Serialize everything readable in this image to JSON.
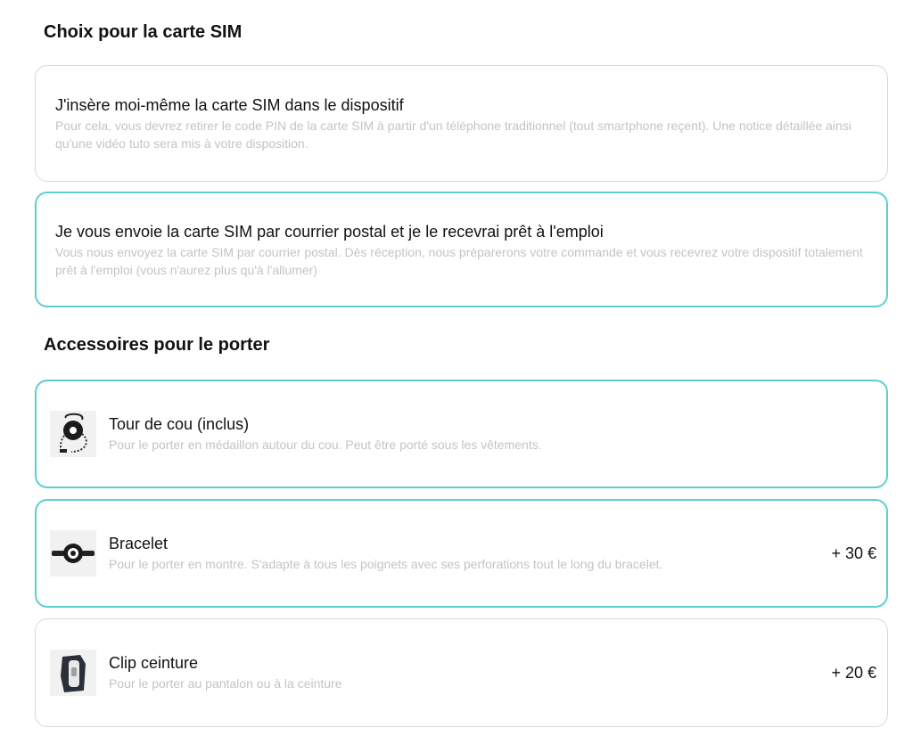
{
  "sim_section": {
    "title": "Choix pour la carte SIM",
    "options": [
      {
        "title": "J'insère moi-même la carte SIM dans le dispositif",
        "description": "Pour cela, vous devrez retirer le code PIN de la carte SIM à partir d'un téléphone traditionnel (tout smartphone reçent). Une notice détaillée ainsi qu'une vidéo tuto sera mis à votre disposition.",
        "selected": false
      },
      {
        "title": "Je vous envoie la carte SIM par courrier postal et je le recevrai prêt à l'emploi",
        "description": "Vous nous envoyez la carte SIM par courrier postal. Dès réception, nous préparerons votre commande et vous recevrez votre dispositif totalement prêt à l'emploi (vous n'aurez plus qu'à l'allumer)",
        "selected": true
      }
    ]
  },
  "accessories_section": {
    "title": "Accessoires pour le porter",
    "options": [
      {
        "icon": "necklace-device-image",
        "title": "Tour de cou (inclus)",
        "description": "Pour le porter en médaillon autour du cou. Peut être porté sous les vêtements.",
        "price": "",
        "selected": true
      },
      {
        "icon": "bracelet-device-image",
        "title": "Bracelet",
        "description": "Pour le porter en montre. S'adapte à tous les poignets avec ses perforations tout le long du bracelet.",
        "price": "+ 30 €",
        "selected": true
      },
      {
        "icon": "belt-clip-device-image",
        "title": "Clip ceinture",
        "description": "Pour le porter au pantalon ou à la ceinture",
        "price": "+ 20 €",
        "selected": false
      }
    ]
  },
  "colors": {
    "selected_border": "#5ccfcf",
    "default_border": "#d9d9d9",
    "description_text": "#c4c4c4"
  }
}
